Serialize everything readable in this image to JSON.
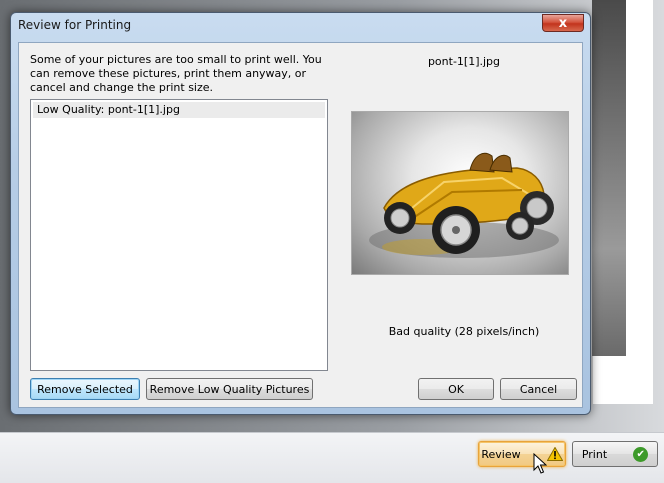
{
  "dialog": {
    "title": "Review for Printing",
    "close_label": "x",
    "description": "Some of your pictures are too small to print well.  You can remove these pictures, print them anyway, or cancel and change the print size.",
    "list_items": [
      "Low Quality: pont-1[1].jpg"
    ],
    "preview_filename": "pont-1[1].jpg",
    "quality_text": "Bad quality (28 pixels/inch)",
    "buttons": {
      "remove_selected": "Remove Selected",
      "remove_low_quality": "Remove Low Quality Pictures",
      "ok": "OK",
      "cancel": "Cancel"
    }
  },
  "wizard": {
    "review_label": "Review",
    "review_icon": "warning-icon",
    "print_label": "Print",
    "print_icon": "checkmark-icon",
    "print_icon_glyph": "✔"
  },
  "colors": {
    "review_highlight": "#e8a33a",
    "close_button": "#c2341d",
    "print_check": "#3d9a2a"
  }
}
